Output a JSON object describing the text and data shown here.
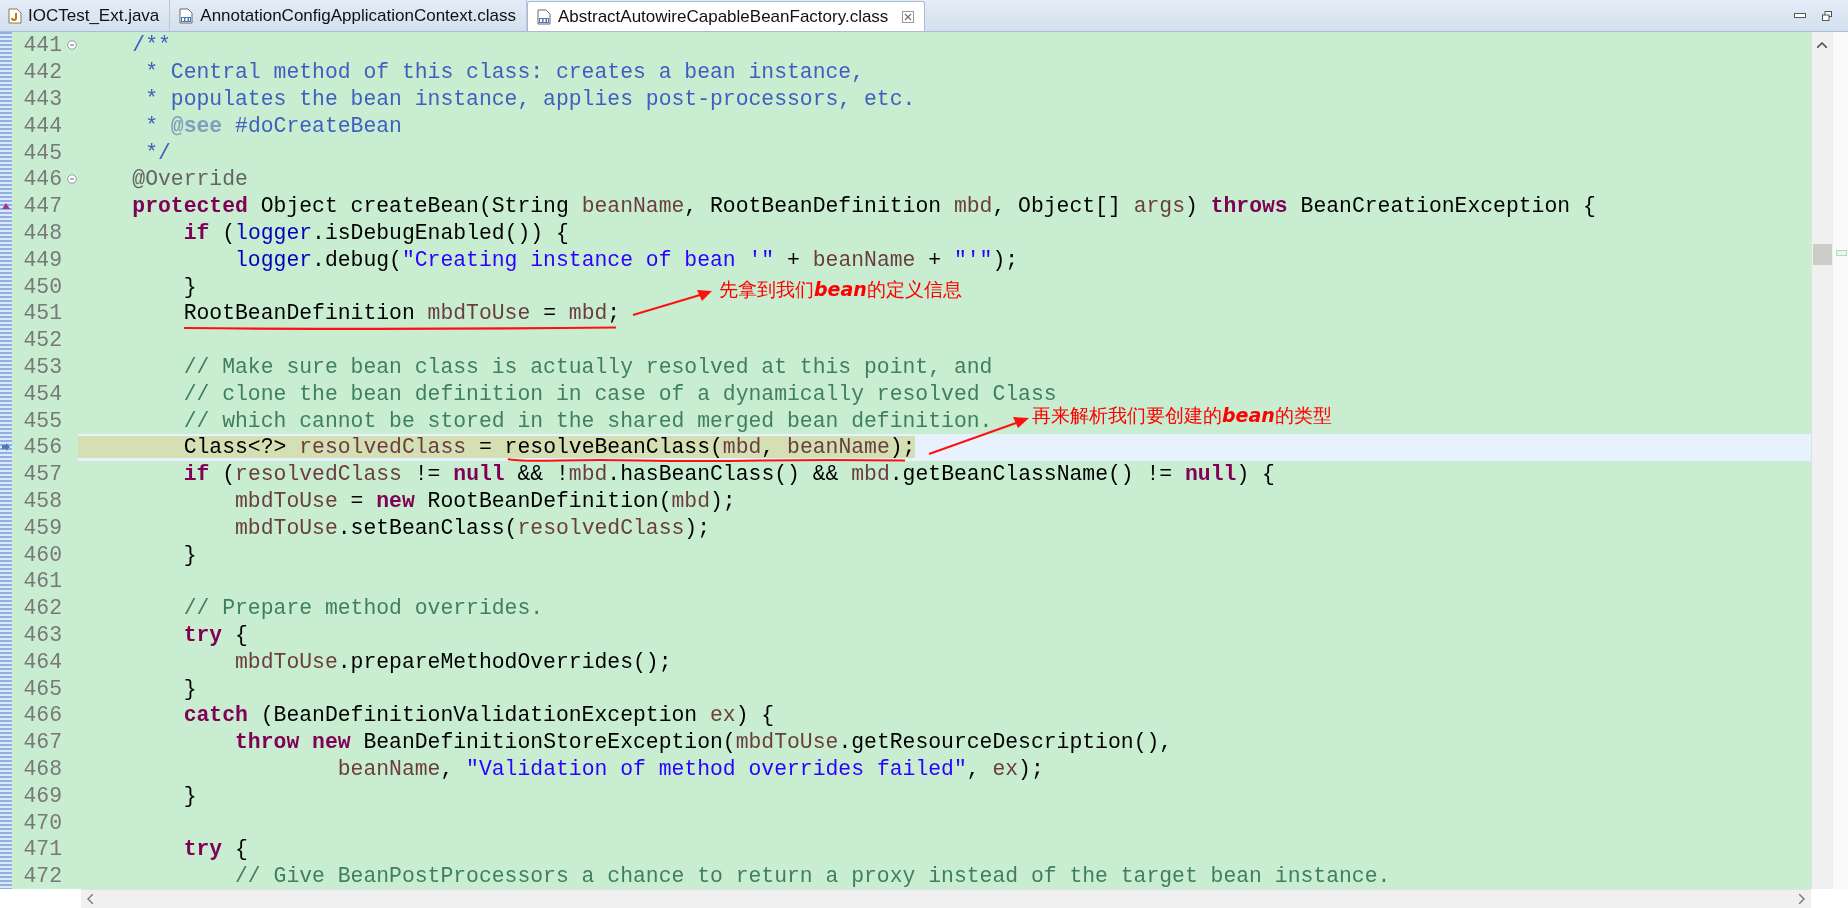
{
  "tabs": [
    {
      "label": "IOCTest_Ext.java",
      "kind": "java",
      "selected": false
    },
    {
      "label": "AnnotationConfigApplicationContext.class",
      "kind": "class",
      "selected": false
    },
    {
      "label": "AbstractAutowireCapableBeanFactory.class",
      "kind": "class",
      "selected": true
    }
  ],
  "editor": {
    "lines": [
      {
        "number": "441",
        "kind": "plain",
        "fold": true,
        "current": false,
        "tokens": [
          {
            "kind": "d",
            "text": "    /**"
          }
        ]
      },
      {
        "number": "442",
        "kind": "plain",
        "fold": false,
        "current": false,
        "tokens": [
          {
            "kind": "d",
            "text": "     * Central method of this class: creates a bean instance,"
          }
        ]
      },
      {
        "number": "443",
        "kind": "plain",
        "fold": false,
        "current": false,
        "tokens": [
          {
            "kind": "d",
            "text": "     * populates the bean instance, applies post-processors, etc."
          }
        ]
      },
      {
        "number": "444",
        "kind": "plain",
        "fold": false,
        "current": false,
        "tokens": [
          {
            "kind": "d",
            "text": "     * "
          },
          {
            "kind": "t",
            "text": "@see"
          },
          {
            "kind": "d",
            "text": " #doCreateBean"
          }
        ]
      },
      {
        "number": "445",
        "kind": "plain",
        "fold": false,
        "current": false,
        "tokens": [
          {
            "kind": "d",
            "text": "     */"
          }
        ]
      },
      {
        "number": "446",
        "kind": "plain",
        "fold": true,
        "current": false,
        "tokens": [
          {
            "kind": "a",
            "text": "    @Override"
          }
        ]
      },
      {
        "number": "447",
        "kind": "override",
        "fold": false,
        "current": false,
        "tokens": [
          {
            "kind": "k",
            "text": "    protected"
          },
          {
            "kind": "p",
            "text": " Object createBean(String "
          },
          {
            "kind": "v",
            "text": "beanName"
          },
          {
            "kind": "p",
            "text": ", RootBeanDefinition "
          },
          {
            "kind": "v",
            "text": "mbd"
          },
          {
            "kind": "p",
            "text": ", Object[] "
          },
          {
            "kind": "v",
            "text": "args"
          },
          {
            "kind": "p",
            "text": ") "
          },
          {
            "kind": "k",
            "text": "throws"
          },
          {
            "kind": "p",
            "text": " BeanCreationException {"
          }
        ]
      },
      {
        "number": "448",
        "kind": "plain",
        "fold": false,
        "current": false,
        "tokens": [
          {
            "kind": "k",
            "text": "        if"
          },
          {
            "kind": "p",
            "text": " ("
          },
          {
            "kind": "f",
            "text": "logger"
          },
          {
            "kind": "p",
            "text": ".isDebugEnabled()) {"
          }
        ]
      },
      {
        "number": "449",
        "kind": "plain",
        "fold": false,
        "current": false,
        "tokens": [
          {
            "kind": "f",
            "text": "            logger"
          },
          {
            "kind": "p",
            "text": ".debug("
          },
          {
            "kind": "s",
            "text": "\"Creating instance of bean '\""
          },
          {
            "kind": "p",
            "text": " + "
          },
          {
            "kind": "v",
            "text": "beanName"
          },
          {
            "kind": "p",
            "text": " + "
          },
          {
            "kind": "s",
            "text": "\"'\""
          },
          {
            "kind": "p",
            "text": ");"
          }
        ]
      },
      {
        "number": "450",
        "kind": "plain",
        "fold": false,
        "current": false,
        "tokens": [
          {
            "kind": "p",
            "text": "        }"
          }
        ]
      },
      {
        "number": "451",
        "kind": "plain",
        "fold": false,
        "current": false,
        "tokens": [
          {
            "kind": "p",
            "text": "        RootBeanDefinition "
          },
          {
            "kind": "v",
            "text": "mbdToUse"
          },
          {
            "kind": "p",
            "text": " = "
          },
          {
            "kind": "v",
            "text": "mbd"
          },
          {
            "kind": "p",
            "text": ";"
          }
        ]
      },
      {
        "number": "452",
        "kind": "plain",
        "fold": false,
        "current": false
      },
      {
        "number": "453",
        "kind": "plain",
        "fold": false,
        "current": false,
        "tokens": [
          {
            "kind": "c",
            "text": "        // Make sure bean class is actually resolved at this point, and"
          }
        ]
      },
      {
        "number": "454",
        "kind": "plain",
        "fold": false,
        "current": false,
        "tokens": [
          {
            "kind": "c",
            "text": "        // clone the bean definition in case of a dynamically resolved Class"
          }
        ]
      },
      {
        "number": "455",
        "kind": "plain",
        "fold": false,
        "current": false,
        "tokens": [
          {
            "kind": "c",
            "text": "        // which cannot be stored in the shared merged bean definition."
          }
        ]
      },
      {
        "number": "456",
        "kind": "instruction",
        "fold": false,
        "current": true,
        "tokens": [
          {
            "kind": "p",
            "text": "        Class<?> "
          },
          {
            "kind": "v",
            "text": "resolvedClass"
          },
          {
            "kind": "p",
            "text": " = resolveBeanClass("
          },
          {
            "kind": "v",
            "text": "mbd"
          },
          {
            "kind": "p",
            "text": ", "
          },
          {
            "kind": "v",
            "text": "beanName"
          },
          {
            "kind": "p",
            "text": ");"
          }
        ]
      },
      {
        "number": "457",
        "kind": "plain",
        "fold": false,
        "current": false,
        "tokens": [
          {
            "kind": "k",
            "text": "        if"
          },
          {
            "kind": "p",
            "text": " ("
          },
          {
            "kind": "v",
            "text": "resolvedClass"
          },
          {
            "kind": "p",
            "text": " != "
          },
          {
            "kind": "k",
            "text": "null"
          },
          {
            "kind": "p",
            "text": " && !"
          },
          {
            "kind": "v",
            "text": "mbd"
          },
          {
            "kind": "p",
            "text": ".hasBeanClass() && "
          },
          {
            "kind": "v",
            "text": "mbd"
          },
          {
            "kind": "p",
            "text": ".getBeanClassName() != "
          },
          {
            "kind": "k",
            "text": "null"
          },
          {
            "kind": "p",
            "text": ") {"
          }
        ]
      },
      {
        "number": "458",
        "kind": "plain",
        "fold": false,
        "current": false,
        "tokens": [
          {
            "kind": "v",
            "text": "            mbdToUse"
          },
          {
            "kind": "p",
            "text": " = "
          },
          {
            "kind": "k",
            "text": "new"
          },
          {
            "kind": "p",
            "text": " RootBeanDefinition("
          },
          {
            "kind": "v",
            "text": "mbd"
          },
          {
            "kind": "p",
            "text": ");"
          }
        ]
      },
      {
        "number": "459",
        "kind": "plain",
        "fold": false,
        "current": false,
        "tokens": [
          {
            "kind": "v",
            "text": "            mbdToUse"
          },
          {
            "kind": "p",
            "text": ".setBeanClass("
          },
          {
            "kind": "v",
            "text": "resolvedClass"
          },
          {
            "kind": "p",
            "text": ");"
          }
        ]
      },
      {
        "number": "460",
        "kind": "plain",
        "fold": false,
        "current": false,
        "tokens": [
          {
            "kind": "p",
            "text": "        }"
          }
        ]
      },
      {
        "number": "461",
        "kind": "plain",
        "fold": false,
        "current": false
      },
      {
        "number": "462",
        "kind": "plain",
        "fold": false,
        "current": false,
        "tokens": [
          {
            "kind": "c",
            "text": "        // Prepare method overrides."
          }
        ]
      },
      {
        "number": "463",
        "kind": "plain",
        "fold": false,
        "current": false,
        "tokens": [
          {
            "kind": "k",
            "text": "        try"
          },
          {
            "kind": "p",
            "text": " {"
          }
        ]
      },
      {
        "number": "464",
        "kind": "plain",
        "fold": false,
        "current": false,
        "tokens": [
          {
            "kind": "v",
            "text": "            mbdToUse"
          },
          {
            "kind": "p",
            "text": ".prepareMethodOverrides();"
          }
        ]
      },
      {
        "number": "465",
        "kind": "plain",
        "fold": false,
        "current": false,
        "tokens": [
          {
            "kind": "p",
            "text": "        }"
          }
        ]
      },
      {
        "number": "466",
        "kind": "plain",
        "fold": false,
        "current": false,
        "tokens": [
          {
            "kind": "k",
            "text": "        catch"
          },
          {
            "kind": "p",
            "text": " (BeanDefinitionValidationException "
          },
          {
            "kind": "v",
            "text": "ex"
          },
          {
            "kind": "p",
            "text": ") {"
          }
        ]
      },
      {
        "number": "467",
        "kind": "plain",
        "fold": false,
        "current": false,
        "tokens": [
          {
            "kind": "k",
            "text": "            throw new"
          },
          {
            "kind": "p",
            "text": " BeanDefinitionStoreException("
          },
          {
            "kind": "v",
            "text": "mbdToUse"
          },
          {
            "kind": "p",
            "text": ".getResourceDescription(),"
          }
        ]
      },
      {
        "number": "468",
        "kind": "plain",
        "fold": false,
        "current": false,
        "tokens": [
          {
            "kind": "v",
            "text": "                    beanName"
          },
          {
            "kind": "p",
            "text": ", "
          },
          {
            "kind": "s",
            "text": "\"Validation of method overrides failed\""
          },
          {
            "kind": "p",
            "text": ", "
          },
          {
            "kind": "v",
            "text": "ex"
          },
          {
            "kind": "p",
            "text": ");"
          }
        ]
      },
      {
        "number": "469",
        "kind": "plain",
        "fold": false,
        "current": false,
        "tokens": [
          {
            "kind": "p",
            "text": "        }"
          }
        ]
      },
      {
        "number": "470",
        "kind": "plain",
        "fold": false,
        "current": false
      },
      {
        "number": "471",
        "kind": "plain",
        "fold": false,
        "current": false,
        "tokens": [
          {
            "kind": "k",
            "text": "        try"
          },
          {
            "kind": "p",
            "text": " {"
          }
        ]
      },
      {
        "number": "472",
        "kind": "plain",
        "fold": false,
        "current": false,
        "tokens": [
          {
            "kind": "c",
            "text": "            // Give BeanPostProcessors a chance to return a proxy instead of the target bean instance."
          }
        ]
      }
    ]
  },
  "callouts": [
    {
      "text": "先拿到我们**bean**的定义信息"
    },
    {
      "text": "再来解析我们要创建的**bean**的类型"
    }
  ]
}
